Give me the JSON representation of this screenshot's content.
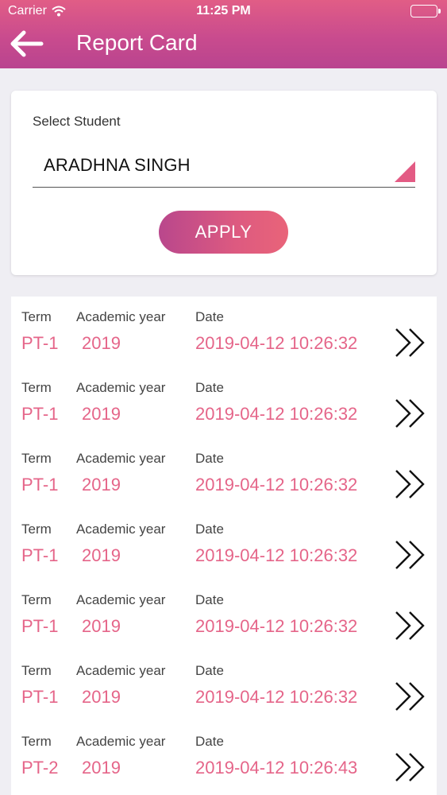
{
  "status_bar": {
    "carrier": "Carrier",
    "time": "11:25 PM"
  },
  "header": {
    "title": "Report Card",
    "back_icon": "back-arrow-icon"
  },
  "student_select": {
    "label": "Select Student",
    "selected": "ARADHNA SINGH",
    "apply_label": "APPLY"
  },
  "list": {
    "labels": {
      "term": "Term",
      "year": "Academic year",
      "date": "Date"
    },
    "rows": [
      {
        "term": "PT-1",
        "year": "2019",
        "date": "2019-04-12 10:26:32"
      },
      {
        "term": "PT-1",
        "year": "2019",
        "date": "2019-04-12 10:26:32"
      },
      {
        "term": "PT-1",
        "year": "2019",
        "date": "2019-04-12 10:26:32"
      },
      {
        "term": "PT-1",
        "year": "2019",
        "date": "2019-04-12 10:26:32"
      },
      {
        "term": "PT-1",
        "year": "2019",
        "date": "2019-04-12 10:26:32"
      },
      {
        "term": "PT-1",
        "year": "2019",
        "date": "2019-04-12 10:26:32"
      },
      {
        "term": "PT-2",
        "year": "2019",
        "date": "2019-04-12 10:26:43"
      }
    ]
  },
  "colors": {
    "accent": "#e56589",
    "header_start": "#e15d86",
    "header_end": "#b9448f"
  }
}
